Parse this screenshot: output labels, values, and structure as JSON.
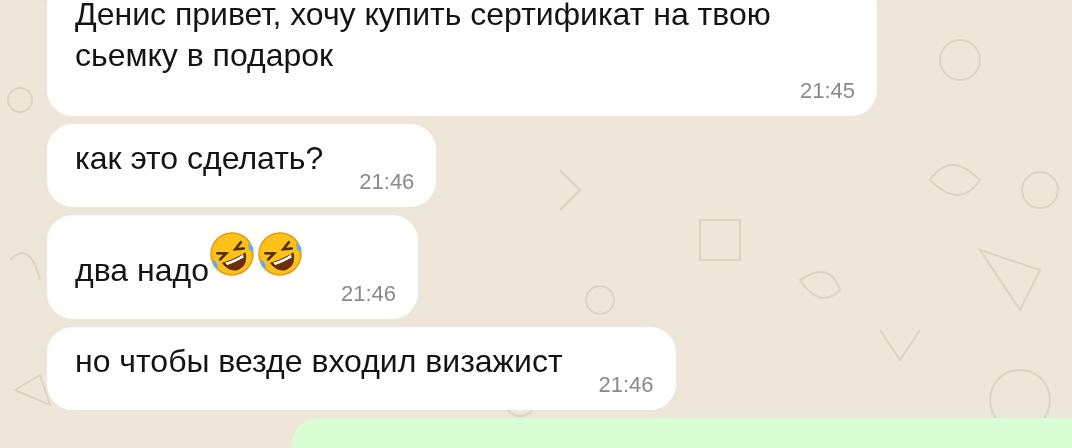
{
  "messages": [
    {
      "kind": "incoming",
      "text": "Денис привет, хочу купить сертификат на твою сьемку в подарок",
      "time": "21:45"
    },
    {
      "kind": "incoming",
      "text": "как это сделать?",
      "time": "21:46"
    },
    {
      "kind": "incoming",
      "text": "два надо",
      "emojis": [
        {
          "kind": "rofl"
        },
        {
          "kind": "rofl"
        }
      ],
      "time": "21:46"
    },
    {
      "kind": "incoming",
      "text": "но чтобы везде входил визажист",
      "time": "21:46"
    },
    {
      "kind": "outgoing"
    }
  ]
}
